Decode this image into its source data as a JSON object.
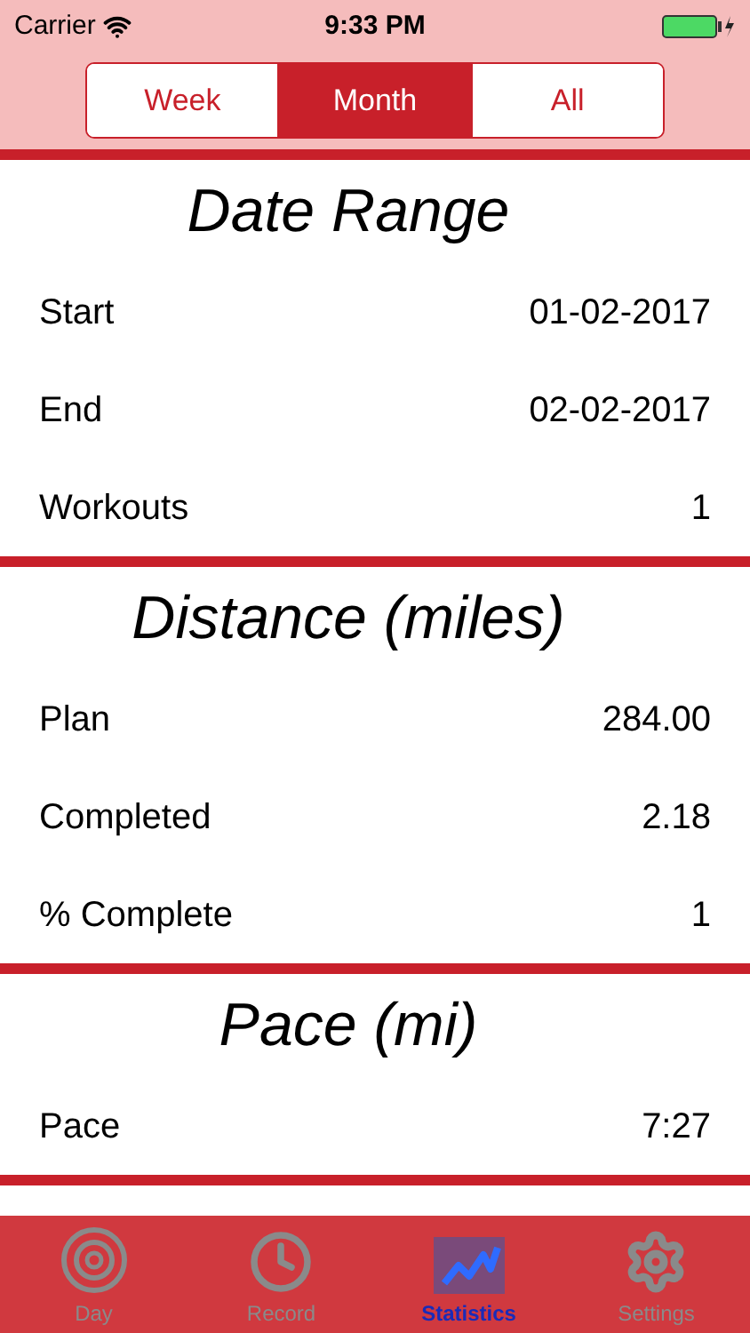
{
  "status_bar": {
    "carrier": "Carrier",
    "time": "9:33 PM"
  },
  "segments": [
    {
      "label": "Week",
      "selected": false
    },
    {
      "label": "Month",
      "selected": true
    },
    {
      "label": "All",
      "selected": false
    }
  ],
  "sections": [
    {
      "title": "Date Range",
      "rows": [
        {
          "label": "Start",
          "value": "01-02-2017"
        },
        {
          "label": "End",
          "value": "02-02-2017"
        },
        {
          "label": "Workouts",
          "value": "1"
        }
      ]
    },
    {
      "title": "Distance (miles)",
      "rows": [
        {
          "label": "Plan",
          "value": "284.00"
        },
        {
          "label": "Completed",
          "value": "2.18"
        },
        {
          "label": "% Complete",
          "value": "1"
        }
      ]
    },
    {
      "title": "Pace (mi)",
      "rows": [
        {
          "label": "Pace",
          "value": "7:27"
        }
      ]
    }
  ],
  "tab_bar": [
    {
      "kind": "target",
      "label": "Day",
      "selected": false
    },
    {
      "kind": "clock",
      "label": "Record",
      "selected": false
    },
    {
      "kind": "chart",
      "label": "Statistics",
      "selected": true
    },
    {
      "kind": "gear",
      "label": "Settings",
      "selected": false
    }
  ]
}
